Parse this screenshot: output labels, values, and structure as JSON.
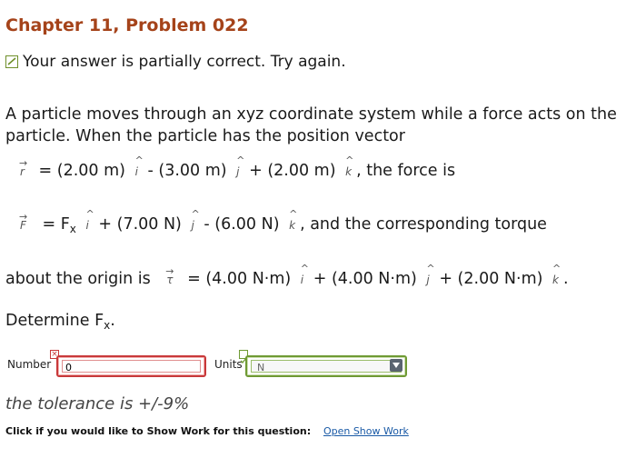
{
  "title": "Chapter 11, Problem 022",
  "status": "Your answer is partially correct.  Try again.",
  "problem": {
    "intro": "A particle moves through an xyz coordinate system while a force acts on the particle. When the particle has the position vector",
    "r_symbol": "r",
    "r_eq": "= (2.00 m)",
    "r_term2": "- (3.00 m)",
    "r_term3": "+ (2.00 m)",
    "r_tail": ", the force is",
    "f_symbol": "F",
    "f_eq": "= F",
    "f_sub": "x",
    "f_term2": "+ (7.00 N)",
    "f_term3": "- (6.00 N)",
    "f_tail": ", and the corresponding torque",
    "t_prefix": "about the origin is",
    "t_symbol": "τ",
    "t_eq": "= (4.00 N·m)",
    "t_term2": "+ (4.00 N·m)",
    "t_term3": "+ (2.00 N·m)",
    "t_tail": ".",
    "unit_i": "i",
    "unit_j": "j",
    "unit_k": "k",
    "determine": "Determine F",
    "determine_sub": "x",
    "determine_tail": "."
  },
  "answer": {
    "number_label": "Number",
    "number_value": "0",
    "units_label": "Units",
    "units_value": "N"
  },
  "tolerance": "the tolerance is +/-9%",
  "show_work": {
    "prompt": "Click if you would like to Show Work for this question:",
    "link": "Open Show Work"
  }
}
